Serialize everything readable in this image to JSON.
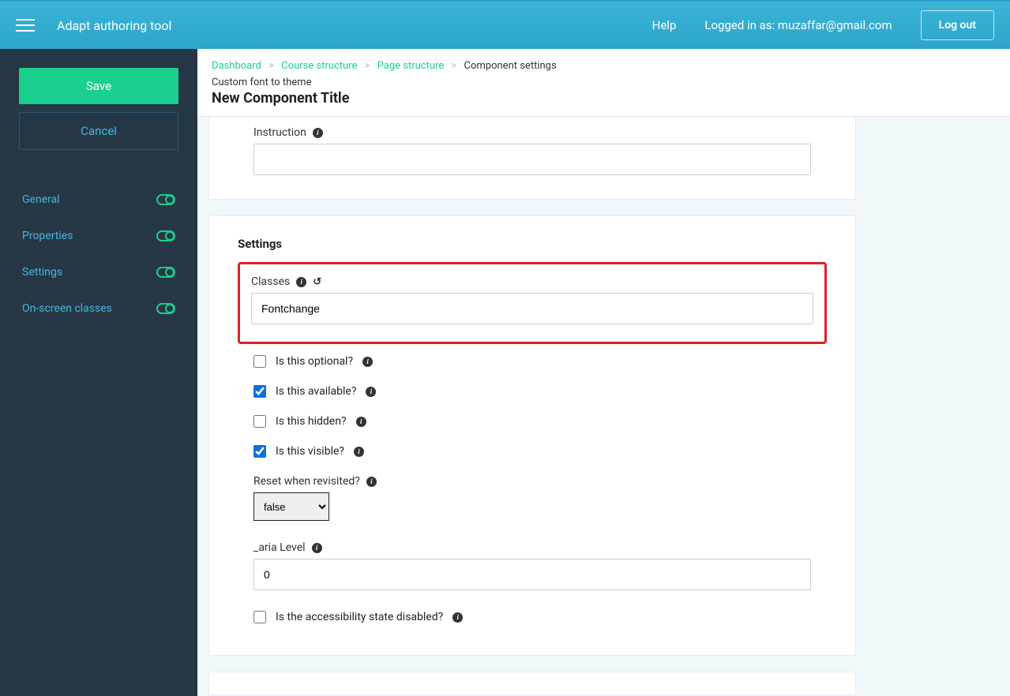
{
  "header": {
    "brand": "Adapt authoring tool",
    "help": "Help",
    "logged_in_as": "Logged in as: muzaffar@gmail.com",
    "logout": "Log out"
  },
  "sidebar": {
    "save": "Save",
    "cancel": "Cancel",
    "nav": [
      {
        "label": "General"
      },
      {
        "label": "Properties"
      },
      {
        "label": "Settings"
      },
      {
        "label": "On-screen classes"
      }
    ]
  },
  "breadcrumb": {
    "items": [
      "Dashboard",
      "Course structure",
      "Page structure"
    ],
    "current": "Component settings"
  },
  "page": {
    "subtitle": "Custom font to theme",
    "title": "New Component Title"
  },
  "instruction": {
    "label": "Instruction",
    "value": ""
  },
  "settings": {
    "heading": "Settings",
    "classes_label": "Classes",
    "classes_value": "Fontchange",
    "optional_label": "Is this optional?",
    "optional_checked": false,
    "available_label": "Is this available?",
    "available_checked": true,
    "hidden_label": "Is this hidden?",
    "hidden_checked": false,
    "visible_label": "Is this visible?",
    "visible_checked": true,
    "reset_label": "Reset when revisited?",
    "reset_value": "false",
    "aria_label": "_aria Level",
    "aria_value": "0",
    "accessibility_label": "Is the accessibility state disabled?",
    "accessibility_checked": false
  }
}
